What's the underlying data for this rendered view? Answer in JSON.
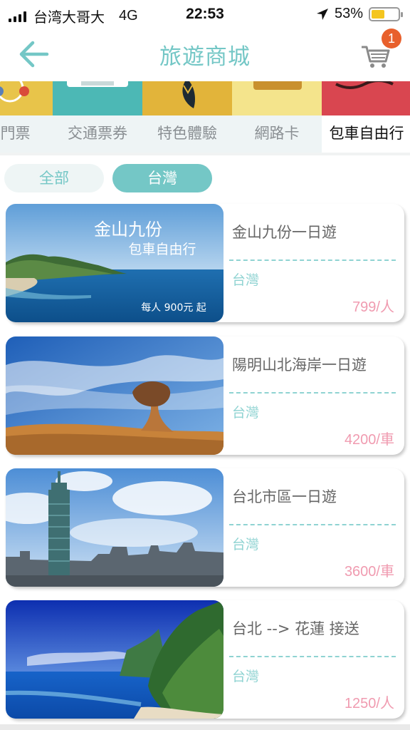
{
  "status_bar": {
    "carrier": "台湾大哥大",
    "network": "4G",
    "time": "22:53",
    "battery": "53%"
  },
  "header": {
    "title": "旅遊商城",
    "cart_count": "1"
  },
  "categories": [
    {
      "label": "園門票"
    },
    {
      "label": "交通票券"
    },
    {
      "label": "特色體驗"
    },
    {
      "label": "網路卡"
    },
    {
      "label": "包車自由行"
    }
  ],
  "filters": {
    "all_label": "全部",
    "taiwan_label": "台灣"
  },
  "products": [
    {
      "name": "金山九份一日遊",
      "region": "台灣",
      "price": "799/人",
      "banner_title": "金山九份",
      "banner_subtitle": "包車自由行",
      "banner_price": "每人 900元 起"
    },
    {
      "name": "陽明山北海岸一日遊",
      "region": "台灣",
      "price": "4200/車"
    },
    {
      "name": "台北市區一日遊",
      "region": "台灣",
      "price": "3600/車"
    },
    {
      "name": "台北 --> 花蓮  接送",
      "region": "台灣",
      "price": "1250/人"
    }
  ],
  "colors": {
    "accent": "#74c7c6",
    "price": "#f09bb0",
    "badge": "#e8602c"
  }
}
